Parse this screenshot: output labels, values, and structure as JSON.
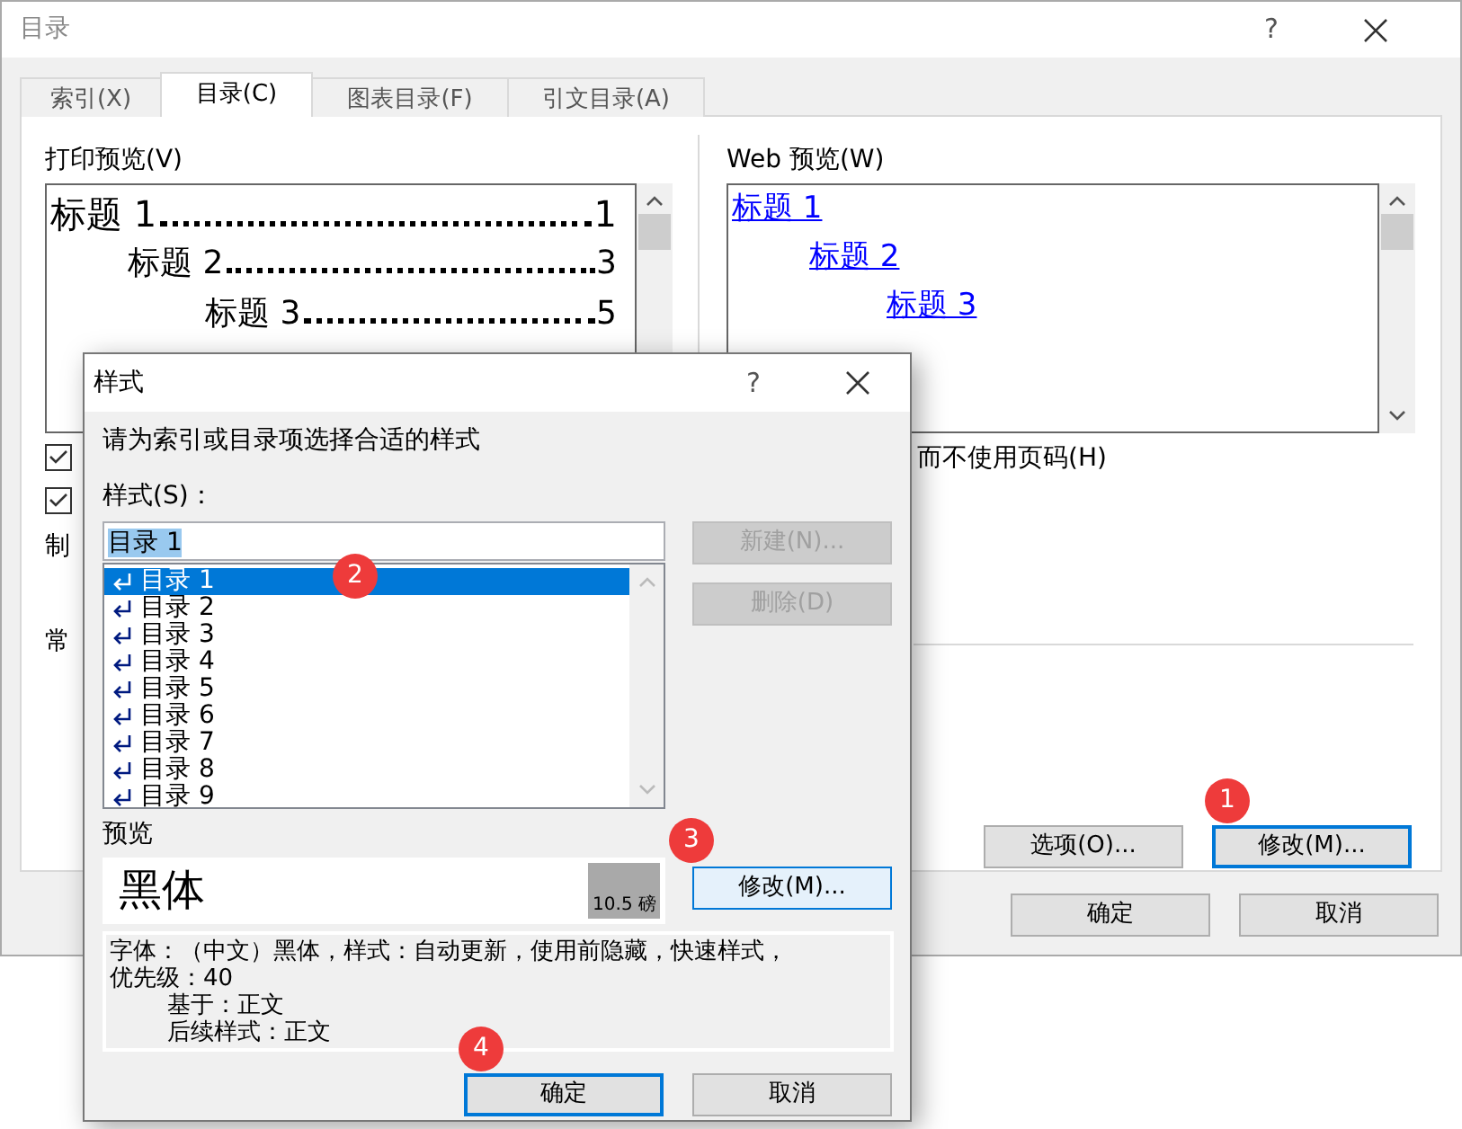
{
  "window": {
    "title": "目录",
    "help": "?"
  },
  "tabs": [
    {
      "label": "索引(X)",
      "selected": false
    },
    {
      "label": "目录(C)",
      "selected": true
    },
    {
      "label": "图表目录(F)",
      "selected": false
    },
    {
      "label": "引文目录(A)",
      "selected": false
    }
  ],
  "print_preview": {
    "label": "打印预览(V)",
    "entries": [
      {
        "text": "标题 1",
        "page": "1"
      },
      {
        "text": "标题 2",
        "page": "3"
      },
      {
        "text": "标题 3",
        "page": "5"
      }
    ]
  },
  "web_preview": {
    "label": "Web 预览(W)",
    "links": [
      "标题 1",
      "标题 2",
      "标题 3"
    ]
  },
  "options": [
    {
      "checked": true
    },
    {
      "checked": true
    }
  ],
  "hyperlink_option_tail": "而不使用页码(H)",
  "partial_labels": [
    "制",
    "常"
  ],
  "action_buttons": [
    {
      "label": "选项(O)...",
      "focused": false
    },
    {
      "label": "修改(M)...",
      "focused": true,
      "badge": "1"
    }
  ],
  "footer_buttons": [
    {
      "label": "确定"
    },
    {
      "label": "取消"
    }
  ],
  "style_dialog": {
    "title": "样式",
    "help": "?",
    "instruction": "请为索引或目录项选择合适的样式",
    "style_label": "样式(S)：",
    "style_value": "目录 1",
    "styles": [
      {
        "label": "目录 1",
        "selected": true,
        "badge": "2"
      },
      {
        "label": "目录 2",
        "selected": false
      },
      {
        "label": "目录 3",
        "selected": false
      },
      {
        "label": "目录 4",
        "selected": false
      },
      {
        "label": "目录 5",
        "selected": false
      },
      {
        "label": "目录 6",
        "selected": false
      },
      {
        "label": "目录 7",
        "selected": false
      },
      {
        "label": "目录 8",
        "selected": false
      },
      {
        "label": "目录 9",
        "selected": false
      }
    ],
    "side_buttons": [
      {
        "label": "新建(N)...",
        "disabled": true
      },
      {
        "label": "删除(D)",
        "disabled": true
      }
    ],
    "preview_label": "预览",
    "preview_text": "黑体",
    "preview_size": "10.5 磅",
    "modify_button": {
      "label": "修改(M)...",
      "badge": "3"
    },
    "description": {
      "lines": [
        "字体：（中文）黑体，样式：自动更新，使用前隐藏，快速样式，",
        "优先级：40"
      ],
      "details": [
        "基于：正文",
        "后续样式：正文"
      ]
    },
    "buttons": [
      {
        "label": "确定",
        "focused": true,
        "badge": "4"
      },
      {
        "label": "取消",
        "focused": false
      }
    ]
  }
}
